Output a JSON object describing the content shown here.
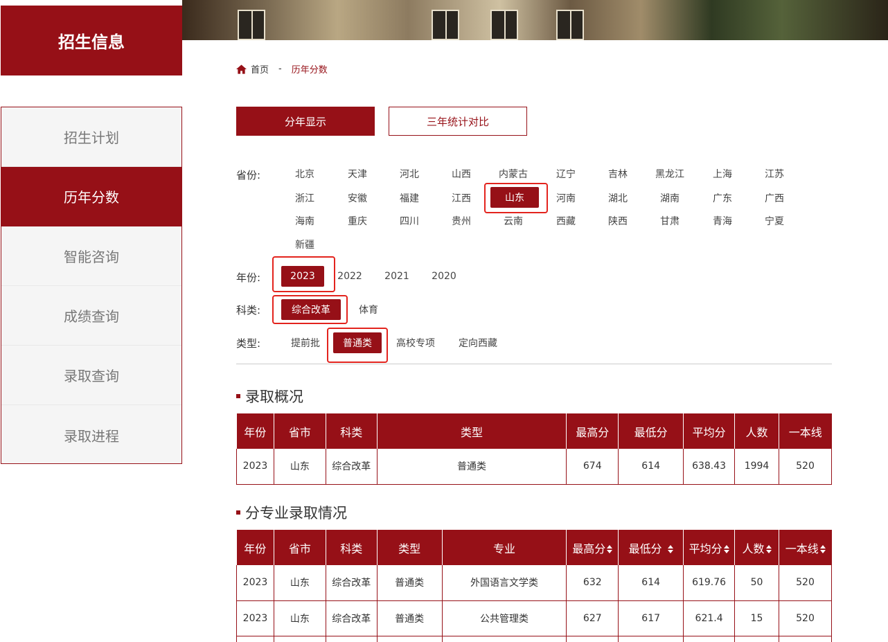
{
  "sidebar": {
    "title": "招生信息",
    "items": [
      {
        "label": "招生计划"
      },
      {
        "label": "历年分数"
      },
      {
        "label": "智能咨询"
      },
      {
        "label": "成绩查询"
      },
      {
        "label": "录取查询"
      },
      {
        "label": "录取进程"
      }
    ],
    "active_index": 1
  },
  "breadcrumb": {
    "home": "首页",
    "separator": "-",
    "current": "历年分数"
  },
  "tabs": {
    "by_year": "分年显示",
    "three_year": "三年统计对比"
  },
  "filters": {
    "province_label": "省份:",
    "provinces": [
      "北京",
      "天津",
      "河北",
      "山西",
      "内蒙古",
      "辽宁",
      "吉林",
      "黑龙江",
      "上海",
      "江苏",
      "浙江",
      "安徽",
      "福建",
      "江西",
      "山东",
      "河南",
      "湖北",
      "湖南",
      "广东",
      "广西",
      "海南",
      "重庆",
      "四川",
      "贵州",
      "云南",
      "西藏",
      "陕西",
      "甘肃",
      "青海",
      "宁夏",
      "新疆"
    ],
    "selected_province": "山东",
    "year_label": "年份:",
    "years": [
      "2023",
      "2022",
      "2021",
      "2020"
    ],
    "selected_year": "2023",
    "subject_label": "科类:",
    "subjects": [
      "综合改革",
      "体育"
    ],
    "selected_subject": "综合改革",
    "type_label": "类型:",
    "types": [
      "提前批",
      "普通类",
      "高校专项",
      "定向西藏"
    ],
    "selected_type": "普通类"
  },
  "overview": {
    "title": "录取概况",
    "headers": [
      "年份",
      "省市",
      "科类",
      "类型",
      "最高分",
      "最低分",
      "平均分",
      "人数",
      "一本线"
    ],
    "rows": [
      [
        "2023",
        "山东",
        "综合改革",
        "普通类",
        "674",
        "614",
        "638.43",
        "1994",
        "520"
      ]
    ]
  },
  "majors": {
    "title": "分专业录取情况",
    "headers": [
      "年份",
      "省市",
      "科类",
      "类型",
      "专业",
      "最高分",
      "最低分",
      "平均分",
      "人数",
      "一本线"
    ],
    "rows": [
      [
        "2023",
        "山东",
        "综合改革",
        "普通类",
        "外国语言文学类",
        "632",
        "614",
        "619.76",
        "50",
        "520"
      ],
      [
        "2023",
        "山东",
        "综合改革",
        "普通类",
        "公共管理类",
        "627",
        "617",
        "621.4",
        "15",
        "520"
      ]
    ]
  },
  "colors": {
    "brand": "#961017",
    "highlight": "#e3231d"
  }
}
